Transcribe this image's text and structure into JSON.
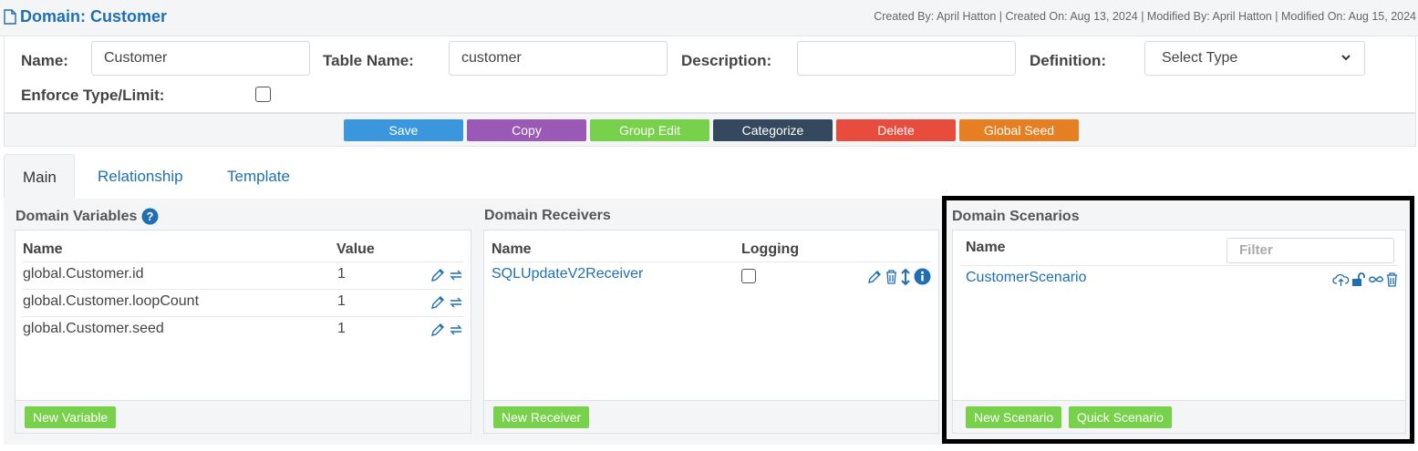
{
  "header": {
    "title": "Domain: Customer",
    "meta": "Created By: April Hatton | Created On: Aug 13, 2024 | Modified By: April Hatton | Modified On: Aug 15, 2024"
  },
  "form": {
    "name_label": "Name:",
    "name_value": "Customer",
    "table_label": "Table Name:",
    "table_value": "customer",
    "description_label": "Description:",
    "description_value": "",
    "definition_label": "Definition:",
    "definition_value": "Select Type",
    "enforce_label": "Enforce Type/Limit:",
    "enforce_checked": false
  },
  "toolbar": {
    "buttons": [
      {
        "label": "Save",
        "color": "#3b97dd"
      },
      {
        "label": "Copy",
        "color": "#9b59b6"
      },
      {
        "label": "Group Edit",
        "color": "#78d14b"
      },
      {
        "label": "Categorize",
        "color": "#34495e"
      },
      {
        "label": "Delete",
        "color": "#e74c3c"
      },
      {
        "label": "Global Seed",
        "color": "#e67e22"
      }
    ]
  },
  "tabs": [
    "Main",
    "Relationship",
    "Template"
  ],
  "variables": {
    "title": "Domain Variables",
    "col_name": "Name",
    "col_value": "Value",
    "rows": [
      {
        "name": "global.Customer.id",
        "value": "1"
      },
      {
        "name": "global.Customer.loopCount",
        "value": "1"
      },
      {
        "name": "global.Customer.seed",
        "value": "1"
      }
    ],
    "new_button": "New Variable"
  },
  "receivers": {
    "title": "Domain Receivers",
    "col_name": "Name",
    "col_logging": "Logging",
    "rows": [
      {
        "name": "SQLUpdateV2Receiver",
        "logging": false
      }
    ],
    "new_button": "New Receiver"
  },
  "scenarios": {
    "title": "Domain Scenarios",
    "col_name": "Name",
    "filter_placeholder": "Filter",
    "rows": [
      {
        "name": "CustomerScenario"
      }
    ],
    "new_button": "New Scenario",
    "quick_button": "Quick Scenario"
  },
  "colors": {
    "accent": "#1f6fb2",
    "green": "#78d14b"
  }
}
